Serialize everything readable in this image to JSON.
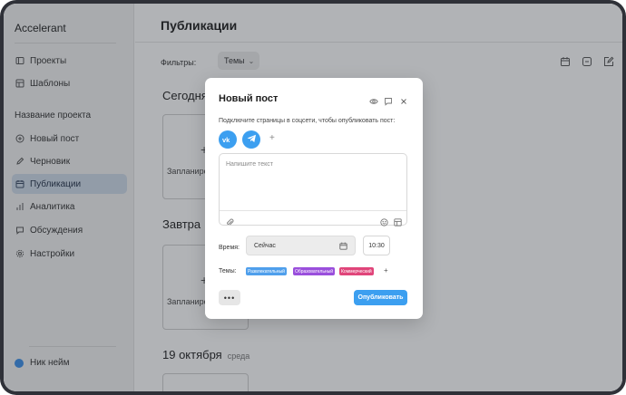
{
  "app": {
    "name": "Accelerant"
  },
  "sidebar": {
    "items": [
      {
        "label": "Проекты",
        "icon": "projects-icon"
      },
      {
        "label": "Шаблоны",
        "icon": "templates-icon"
      }
    ],
    "section_title": "Название проекта",
    "project_items": [
      {
        "label": "Новый пост",
        "icon": "plus-circle-icon"
      },
      {
        "label": "Черновик",
        "icon": "pencil-icon"
      },
      {
        "label": "Публикации",
        "icon": "calendar-icon",
        "active": true
      },
      {
        "label": "Аналитика",
        "icon": "bar-chart-icon"
      },
      {
        "label": "Обсуждения",
        "icon": "chat-icon"
      },
      {
        "label": "Настройки",
        "icon": "gear-icon"
      }
    ],
    "user": {
      "name": "Ник нейм",
      "avatar_color": "#3b8fea"
    }
  },
  "main": {
    "title": "Публикации",
    "filters_label": "Фильтры:",
    "filter_select": "Темы",
    "days": [
      {
        "title": "Сегодня",
        "subtitle": "",
        "slot_text": "Запланировать"
      },
      {
        "title": "Завтра",
        "subtitle": "",
        "slot_text": "Запланировать"
      },
      {
        "title": "19 октября",
        "subtitle": "среда",
        "slot_text": ""
      }
    ]
  },
  "modal": {
    "title": "Новый пост",
    "connect_text": "Подключите страницы в соцсети, чтобы опубликовать пост:",
    "socials": [
      {
        "name": "VK",
        "icon": "vk-icon"
      },
      {
        "name": "Telegram",
        "icon": "telegram-icon"
      }
    ],
    "socials_add": "+",
    "editor_placeholder": "Напишите текст",
    "time_label": "Время:",
    "time_value": "Сейчас",
    "clock_value": "10:30",
    "themes_label": "Темы:",
    "tags": [
      {
        "label": "Развлекательный",
        "color": "#4f9fec"
      },
      {
        "label": "Образовательный",
        "color": "#9a4fdc"
      },
      {
        "label": "Коммерческий",
        "color": "#e0457a"
      }
    ],
    "tags_add": "+",
    "more_label": "•••",
    "publish_label": "Опубликовать"
  },
  "colors": {
    "accent": "#3c9ff0",
    "active_nav": "#cfdbea"
  }
}
